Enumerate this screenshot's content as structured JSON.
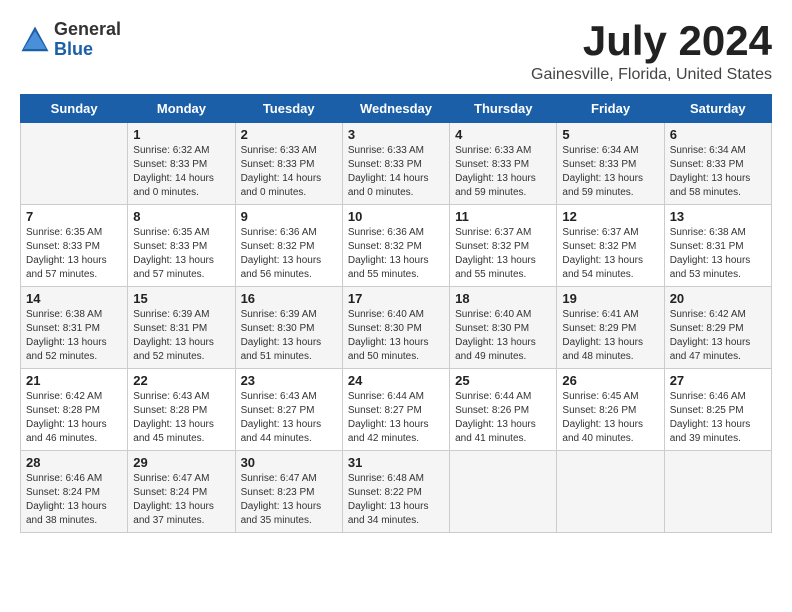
{
  "header": {
    "logo_general": "General",
    "logo_blue": "Blue",
    "main_title": "July 2024",
    "subtitle": "Gainesville, Florida, United States"
  },
  "calendar": {
    "days_of_week": [
      "Sunday",
      "Monday",
      "Tuesday",
      "Wednesday",
      "Thursday",
      "Friday",
      "Saturday"
    ],
    "weeks": [
      [
        {
          "day": "",
          "info": ""
        },
        {
          "day": "1",
          "info": "Sunrise: 6:32 AM\nSunset: 8:33 PM\nDaylight: 14 hours\nand 0 minutes."
        },
        {
          "day": "2",
          "info": "Sunrise: 6:33 AM\nSunset: 8:33 PM\nDaylight: 14 hours\nand 0 minutes."
        },
        {
          "day": "3",
          "info": "Sunrise: 6:33 AM\nSunset: 8:33 PM\nDaylight: 14 hours\nand 0 minutes."
        },
        {
          "day": "4",
          "info": "Sunrise: 6:33 AM\nSunset: 8:33 PM\nDaylight: 13 hours\nand 59 minutes."
        },
        {
          "day": "5",
          "info": "Sunrise: 6:34 AM\nSunset: 8:33 PM\nDaylight: 13 hours\nand 59 minutes."
        },
        {
          "day": "6",
          "info": "Sunrise: 6:34 AM\nSunset: 8:33 PM\nDaylight: 13 hours\nand 58 minutes."
        }
      ],
      [
        {
          "day": "7",
          "info": "Sunrise: 6:35 AM\nSunset: 8:33 PM\nDaylight: 13 hours\nand 57 minutes."
        },
        {
          "day": "8",
          "info": "Sunrise: 6:35 AM\nSunset: 8:33 PM\nDaylight: 13 hours\nand 57 minutes."
        },
        {
          "day": "9",
          "info": "Sunrise: 6:36 AM\nSunset: 8:32 PM\nDaylight: 13 hours\nand 56 minutes."
        },
        {
          "day": "10",
          "info": "Sunrise: 6:36 AM\nSunset: 8:32 PM\nDaylight: 13 hours\nand 55 minutes."
        },
        {
          "day": "11",
          "info": "Sunrise: 6:37 AM\nSunset: 8:32 PM\nDaylight: 13 hours\nand 55 minutes."
        },
        {
          "day": "12",
          "info": "Sunrise: 6:37 AM\nSunset: 8:32 PM\nDaylight: 13 hours\nand 54 minutes."
        },
        {
          "day": "13",
          "info": "Sunrise: 6:38 AM\nSunset: 8:31 PM\nDaylight: 13 hours\nand 53 minutes."
        }
      ],
      [
        {
          "day": "14",
          "info": "Sunrise: 6:38 AM\nSunset: 8:31 PM\nDaylight: 13 hours\nand 52 minutes."
        },
        {
          "day": "15",
          "info": "Sunrise: 6:39 AM\nSunset: 8:31 PM\nDaylight: 13 hours\nand 52 minutes."
        },
        {
          "day": "16",
          "info": "Sunrise: 6:39 AM\nSunset: 8:30 PM\nDaylight: 13 hours\nand 51 minutes."
        },
        {
          "day": "17",
          "info": "Sunrise: 6:40 AM\nSunset: 8:30 PM\nDaylight: 13 hours\nand 50 minutes."
        },
        {
          "day": "18",
          "info": "Sunrise: 6:40 AM\nSunset: 8:30 PM\nDaylight: 13 hours\nand 49 minutes."
        },
        {
          "day": "19",
          "info": "Sunrise: 6:41 AM\nSunset: 8:29 PM\nDaylight: 13 hours\nand 48 minutes."
        },
        {
          "day": "20",
          "info": "Sunrise: 6:42 AM\nSunset: 8:29 PM\nDaylight: 13 hours\nand 47 minutes."
        }
      ],
      [
        {
          "day": "21",
          "info": "Sunrise: 6:42 AM\nSunset: 8:28 PM\nDaylight: 13 hours\nand 46 minutes."
        },
        {
          "day": "22",
          "info": "Sunrise: 6:43 AM\nSunset: 8:28 PM\nDaylight: 13 hours\nand 45 minutes."
        },
        {
          "day": "23",
          "info": "Sunrise: 6:43 AM\nSunset: 8:27 PM\nDaylight: 13 hours\nand 44 minutes."
        },
        {
          "day": "24",
          "info": "Sunrise: 6:44 AM\nSunset: 8:27 PM\nDaylight: 13 hours\nand 42 minutes."
        },
        {
          "day": "25",
          "info": "Sunrise: 6:44 AM\nSunset: 8:26 PM\nDaylight: 13 hours\nand 41 minutes."
        },
        {
          "day": "26",
          "info": "Sunrise: 6:45 AM\nSunset: 8:26 PM\nDaylight: 13 hours\nand 40 minutes."
        },
        {
          "day": "27",
          "info": "Sunrise: 6:46 AM\nSunset: 8:25 PM\nDaylight: 13 hours\nand 39 minutes."
        }
      ],
      [
        {
          "day": "28",
          "info": "Sunrise: 6:46 AM\nSunset: 8:24 PM\nDaylight: 13 hours\nand 38 minutes."
        },
        {
          "day": "29",
          "info": "Sunrise: 6:47 AM\nSunset: 8:24 PM\nDaylight: 13 hours\nand 37 minutes."
        },
        {
          "day": "30",
          "info": "Sunrise: 6:47 AM\nSunset: 8:23 PM\nDaylight: 13 hours\nand 35 minutes."
        },
        {
          "day": "31",
          "info": "Sunrise: 6:48 AM\nSunset: 8:22 PM\nDaylight: 13 hours\nand 34 minutes."
        },
        {
          "day": "",
          "info": ""
        },
        {
          "day": "",
          "info": ""
        },
        {
          "day": "",
          "info": ""
        }
      ]
    ]
  }
}
